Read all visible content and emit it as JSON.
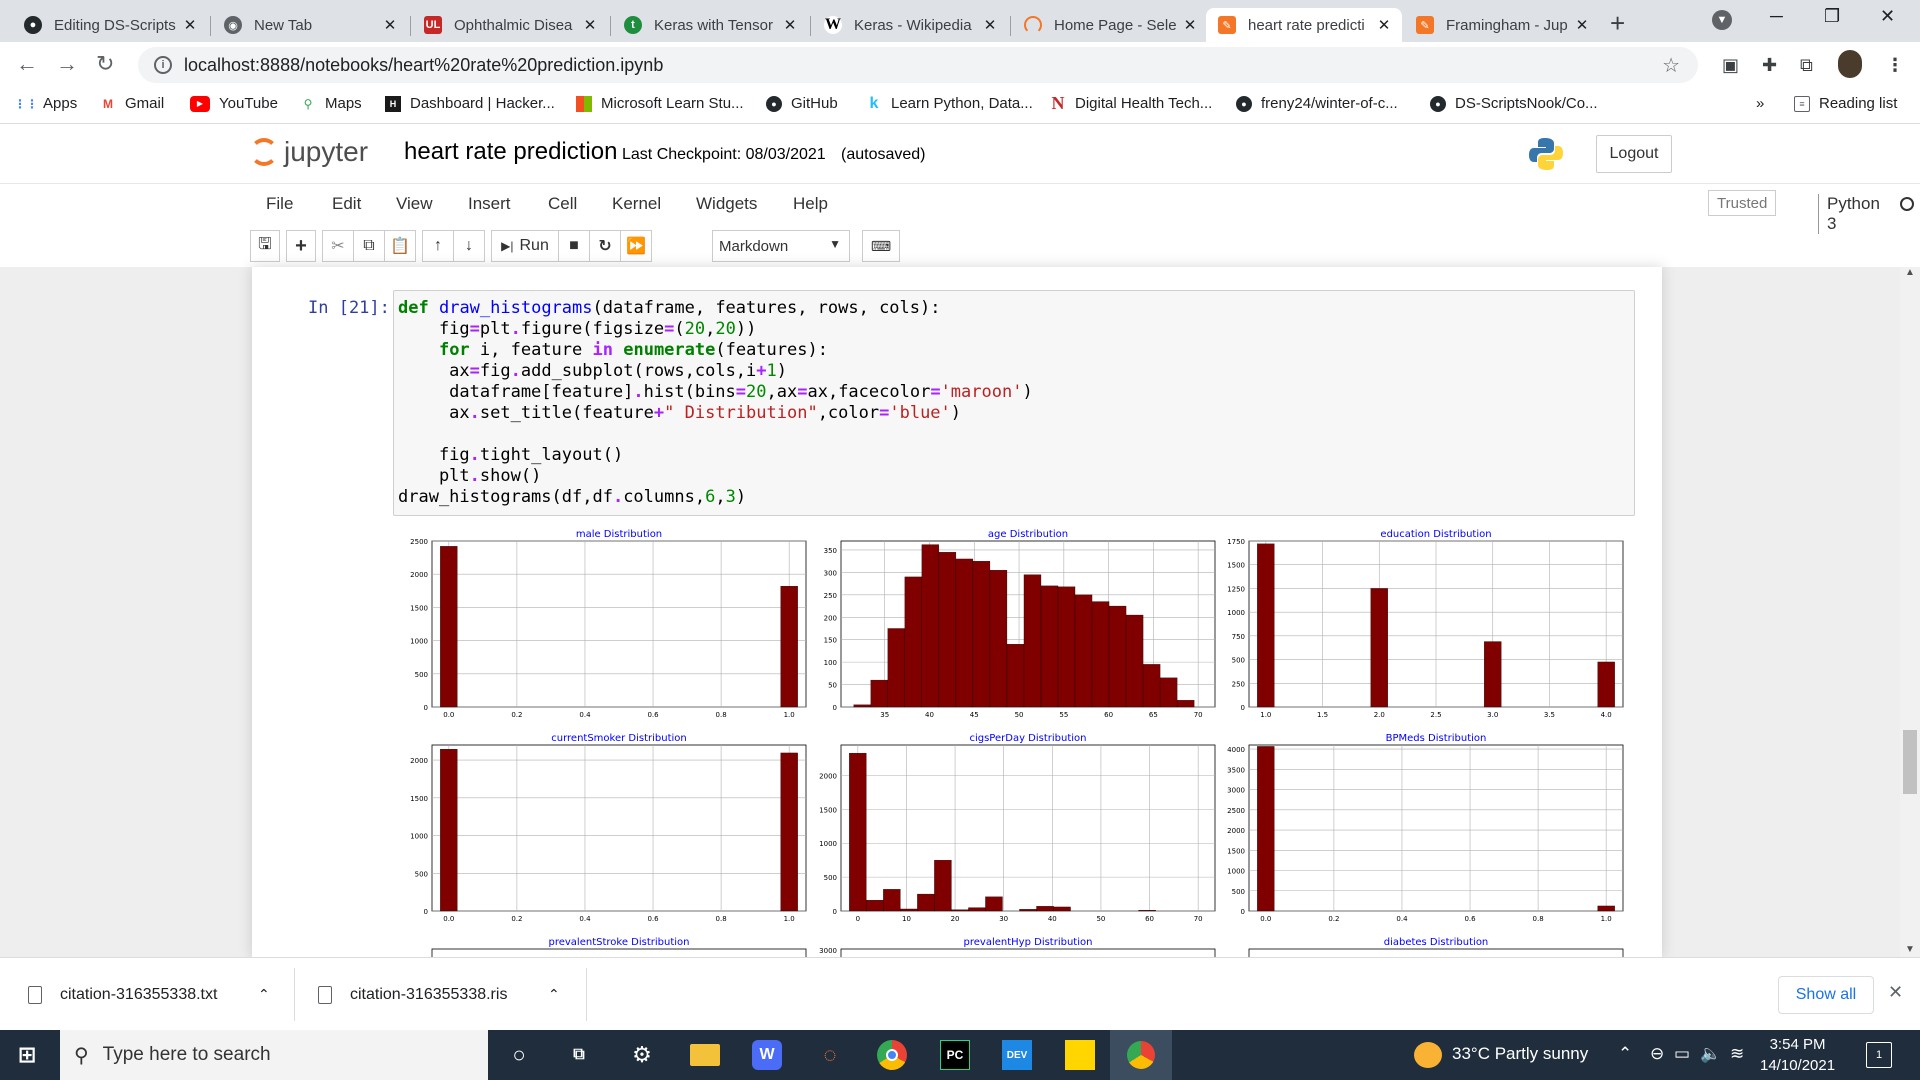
{
  "browser": {
    "tabs": [
      {
        "label": "Editing DS-Scripts",
        "icon": "github-icon",
        "active": false
      },
      {
        "label": "New Tab",
        "icon": "chrome-icon",
        "active": false
      },
      {
        "label": "Ophthalmic Disea",
        "icon": "ul-icon",
        "active": false
      },
      {
        "label": "Keras with Tensor",
        "icon": "tensorflow-icon",
        "active": false
      },
      {
        "label": "Keras - Wikipedia",
        "icon": "wikipedia-icon",
        "active": false
      },
      {
        "label": "Home Page - Sele",
        "icon": "loading-icon",
        "active": false
      },
      {
        "label": "heart rate predicti",
        "icon": "jupyter-icon",
        "active": true
      },
      {
        "label": "Framingham - Jup",
        "icon": "jupyter-icon",
        "active": false
      }
    ],
    "url": "localhost:8888/notebooks/heart%20rate%20prediction.ipynb",
    "bookmarks": [
      {
        "label": "Apps",
        "icon": "apps-icon"
      },
      {
        "label": "Gmail",
        "icon": "gmail-icon"
      },
      {
        "label": "YouTube",
        "icon": "youtube-icon"
      },
      {
        "label": "Maps",
        "icon": "maps-icon"
      },
      {
        "label": "Dashboard | Hacker...",
        "icon": "hackerrank-icon"
      },
      {
        "label": "Microsoft Learn Stu...",
        "icon": "microsoft-icon"
      },
      {
        "label": "GitHub",
        "icon": "github-icon"
      },
      {
        "label": "Learn Python, Data...",
        "icon": "kaggle-icon"
      },
      {
        "label": "Digital Health Tech...",
        "icon": "n-icon"
      },
      {
        "label": "freny24/winter-of-c...",
        "icon": "github-icon"
      },
      {
        "label": "DS-ScriptsNook/Co...",
        "icon": "github-icon"
      }
    ],
    "more_bookmarks": "»",
    "reading_list": "Reading list"
  },
  "jupyter": {
    "logo_text": "jupyter",
    "notebook_title": "heart rate prediction",
    "checkpoint": "Last Checkpoint: 08/03/2021",
    "autosave": "(autosaved)",
    "logout": "Logout",
    "menu": [
      "File",
      "Edit",
      "View",
      "Insert",
      "Cell",
      "Kernel",
      "Widgets",
      "Help"
    ],
    "trusted": "Trusted",
    "kernel": "Python 3",
    "run_label": "Run",
    "cell_mode": "Markdown"
  },
  "cell": {
    "prompt": "In [21]:",
    "code_lines": [
      "def draw_histograms(dataframe, features, rows, cols):",
      "    fig=plt.figure(figsize=(20,20))",
      "    for i, feature in enumerate(features):",
      "     ax=fig.add_subplot(rows,cols,i+1)",
      "     dataframe[feature].hist(bins=20,ax=ax,facecolor='maroon')",
      "     ax.set_title(feature+\" Distribution\",color='blue')",
      "",
      "    fig.tight_layout()",
      "    plt.show()",
      "draw_histograms(df,df.columns,6,3)"
    ]
  },
  "chart_data": [
    {
      "type": "bar",
      "title": "male Distribution",
      "xlim": [
        0,
        1
      ],
      "ylim": [
        0,
        2500
      ],
      "xticks": [
        "0.0",
        "0.2",
        "0.4",
        "0.6",
        "0.8",
        "1.0"
      ],
      "yticks": [
        "0",
        "500",
        "1000",
        "1500",
        "2000",
        "2500"
      ],
      "bars": [
        {
          "x": 0.0,
          "value": 2420
        },
        {
          "x": 1.0,
          "value": 1820
        }
      ]
    },
    {
      "type": "bar",
      "title": "age Distribution",
      "xlim": [
        32,
        70
      ],
      "ylim": [
        0,
        370
      ],
      "xticks": [
        "35",
        "40",
        "45",
        "50",
        "55",
        "60",
        "65",
        "70"
      ],
      "yticks": [
        "0",
        "50",
        "100",
        "150",
        "200",
        "250",
        "300",
        "350"
      ],
      "bars": [
        {
          "x": 32.5,
          "value": 5
        },
        {
          "x": 34.4,
          "value": 60
        },
        {
          "x": 36.3,
          "value": 175
        },
        {
          "x": 38.2,
          "value": 290
        },
        {
          "x": 40.1,
          "value": 362
        },
        {
          "x": 42.0,
          "value": 345
        },
        {
          "x": 43.9,
          "value": 330
        },
        {
          "x": 45.8,
          "value": 325
        },
        {
          "x": 47.7,
          "value": 305
        },
        {
          "x": 49.6,
          "value": 140
        },
        {
          "x": 51.5,
          "value": 295
        },
        {
          "x": 53.4,
          "value": 270
        },
        {
          "x": 55.3,
          "value": 268
        },
        {
          "x": 57.2,
          "value": 250
        },
        {
          "x": 59.1,
          "value": 235
        },
        {
          "x": 61.0,
          "value": 225
        },
        {
          "x": 62.9,
          "value": 205
        },
        {
          "x": 64.8,
          "value": 95
        },
        {
          "x": 66.7,
          "value": 65
        },
        {
          "x": 68.6,
          "value": 15
        }
      ]
    },
    {
      "type": "bar",
      "title": "education Distribution",
      "xlim": [
        1,
        4
      ],
      "ylim": [
        0,
        1750
      ],
      "xticks": [
        "1.0",
        "1.5",
        "2.0",
        "2.5",
        "3.0",
        "3.5",
        "4.0"
      ],
      "yticks": [
        "0",
        "250",
        "500",
        "750",
        "1000",
        "1250",
        "1500",
        "1750"
      ],
      "bars": [
        {
          "x": 1.0,
          "value": 1720
        },
        {
          "x": 2.0,
          "value": 1250
        },
        {
          "x": 3.0,
          "value": 690
        },
        {
          "x": 4.0,
          "value": 475
        }
      ]
    },
    {
      "type": "bar",
      "title": "currentSmoker Distribution",
      "xlim": [
        0,
        1
      ],
      "ylim": [
        0,
        2200
      ],
      "xticks": [
        "0.0",
        "0.2",
        "0.4",
        "0.6",
        "0.8",
        "1.0"
      ],
      "yticks": [
        "0",
        "500",
        "1000",
        "1500",
        "2000"
      ],
      "bars": [
        {
          "x": 0.0,
          "value": 2145
        },
        {
          "x": 1.0,
          "value": 2095
        }
      ]
    },
    {
      "type": "bar",
      "title": "cigsPerDay Distribution",
      "xlim": [
        0,
        70
      ],
      "ylim": [
        0,
        2450
      ],
      "xticks": [
        "0",
        "10",
        "20",
        "30",
        "40",
        "50",
        "60",
        "70"
      ],
      "yticks": [
        "0",
        "500",
        "1000",
        "1500",
        "2000"
      ],
      "bars": [
        {
          "x": 0,
          "value": 2330
        },
        {
          "x": 3.5,
          "value": 160
        },
        {
          "x": 7,
          "value": 320
        },
        {
          "x": 10.5,
          "value": 30
        },
        {
          "x": 14,
          "value": 250
        },
        {
          "x": 17.5,
          "value": 750
        },
        {
          "x": 21,
          "value": 20
        },
        {
          "x": 24.5,
          "value": 50
        },
        {
          "x": 28,
          "value": 210
        },
        {
          "x": 35,
          "value": 25
        },
        {
          "x": 38.5,
          "value": 70
        },
        {
          "x": 42,
          "value": 60
        },
        {
          "x": 59.5,
          "value": 12
        }
      ]
    },
    {
      "type": "bar",
      "title": "BPMeds Distribution",
      "xlim": [
        0,
        1
      ],
      "ylim": [
        0,
        4100
      ],
      "xticks": [
        "0.0",
        "0.2",
        "0.4",
        "0.6",
        "0.8",
        "1.0"
      ],
      "yticks": [
        "0",
        "500",
        "1000",
        "1500",
        "2000",
        "2500",
        "3000",
        "3500",
        "4000"
      ],
      "bars": [
        {
          "x": 0.0,
          "value": 4065
        },
        {
          "x": 1.0,
          "value": 125
        }
      ]
    },
    {
      "type": "bar",
      "title": "prevalentStroke Distribution",
      "bars": [],
      "yticks": []
    },
    {
      "type": "bar",
      "title": "prevalentHyp Distribution",
      "bars": [],
      "yticks": [
        "3000"
      ]
    },
    {
      "type": "bar",
      "title": "diabetes Distribution",
      "bars": [],
      "yticks": []
    }
  ],
  "downloads": [
    {
      "name": "citation-316355338.txt"
    },
    {
      "name": "citation-316355338.ris"
    }
  ],
  "show_all": "Show all",
  "taskbar": {
    "search_placeholder": "Type here to search",
    "weather": "33°C  Partly sunny",
    "time": "3:54 PM",
    "date": "14/10/2021",
    "notifications": "1"
  },
  "colors": {
    "bar": "#800000",
    "title": "#0000ff",
    "jupyter_orange": "#f37726",
    "tab_bg": "#dee1e6"
  }
}
